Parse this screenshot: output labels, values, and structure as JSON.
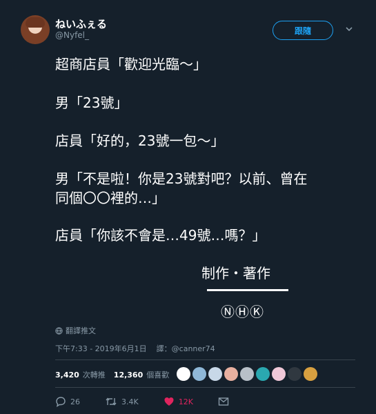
{
  "user": {
    "name": "ねいふぇる",
    "handle": "@Nyfel_",
    "follow_label": "跟隨"
  },
  "tweet": {
    "lines": [
      "超商店員「歡迎光臨～」",
      "男「23號」",
      "店員「好的，23號一包～」",
      "男「不是啦！你是23號對吧？以前、曾在",
      "同個〇〇裡的…」",
      "店員「你該不會是…49號…嗎？」"
    ],
    "credit": "制作・著作",
    "nhk": "ⓃⒽⓀ",
    "translate_label": "翻譯推文",
    "timestamp": "下午7:33 - 2019年6月1日",
    "translator_note": "譯：@canner74"
  },
  "stats": {
    "retweets": "3,420",
    "retweets_label": "次轉推",
    "likes": "12,360",
    "likes_label": "個喜歡"
  },
  "likers": [
    "#ffffff",
    "#8fb8d8",
    "#c8d8e8",
    "#e8b0a0",
    "#b8c0c8",
    "#2aa8b0",
    "#f0c8d8",
    "#303840",
    "#d8a040"
  ],
  "actions": {
    "replies": "26",
    "retweets": "3.4K",
    "likes": "12K"
  },
  "colors": {
    "background": "#15202b",
    "accent": "#1da1f2",
    "muted": "#8899a6",
    "like": "#e0245e"
  }
}
